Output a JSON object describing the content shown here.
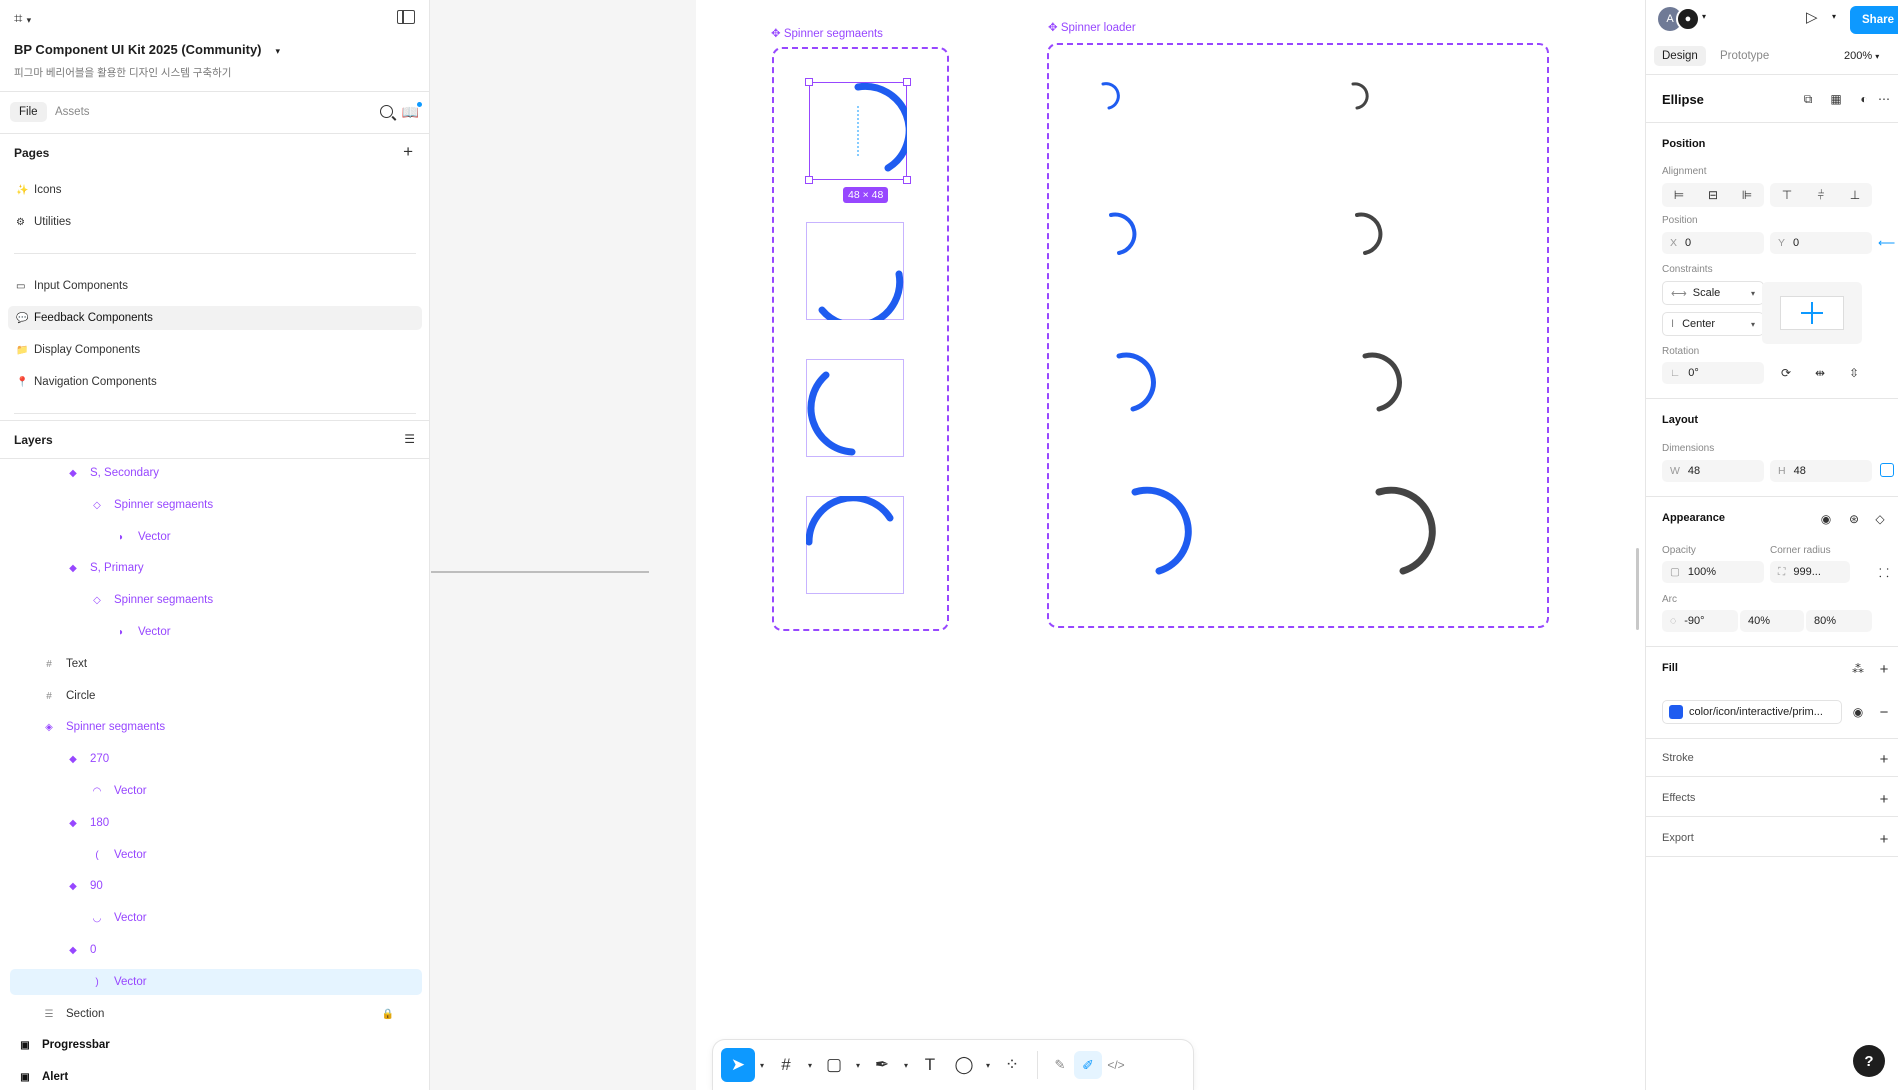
{
  "app": {
    "file_name": "BP Component UI Kit 2025 (Community)",
    "file_subtitle": "피그마 베리어블을 활용한 디자인 시스템 구축하기",
    "tabs": [
      "File",
      "Assets"
    ]
  },
  "pages": {
    "title": "Pages",
    "items": [
      {
        "icon": "✨",
        "label": "Icons"
      },
      {
        "icon": "⚙",
        "label": "Utilities"
      },
      {
        "icon": "▭",
        "label": "Input Components"
      },
      {
        "icon": "💬",
        "label": "Feedback Components",
        "active": true
      },
      {
        "icon": "📁",
        "label": "Display Components"
      },
      {
        "icon": "📍",
        "label": "Navigation Components"
      }
    ]
  },
  "layers": {
    "title": "Layers",
    "items": [
      {
        "label": "S, Secondary",
        "icon": "◆",
        "indent": 2,
        "style": "purple"
      },
      {
        "label": "Spinner segmaents",
        "icon": "◇",
        "indent": 3,
        "style": "purple"
      },
      {
        "label": "Vector",
        "icon": "◗",
        "indent": 4,
        "style": "purple"
      },
      {
        "label": "S, Primary",
        "icon": "◆",
        "indent": 2,
        "style": "purple"
      },
      {
        "label": "Spinner segmaents",
        "icon": "◇",
        "indent": 3,
        "style": "purple"
      },
      {
        "label": "Vector",
        "icon": "◗",
        "indent": 4,
        "style": "purple"
      },
      {
        "label": "Text",
        "icon": "#",
        "indent": 1,
        "style": "gray"
      },
      {
        "label": "Circle",
        "icon": "#",
        "indent": 1,
        "style": "gray"
      },
      {
        "label": "Spinner segmaents",
        "icon": "◈",
        "indent": 1,
        "style": "purple"
      },
      {
        "label": "270",
        "icon": "◆",
        "indent": 2,
        "style": "purple"
      },
      {
        "label": "Vector",
        "icon": "◠",
        "indent": 3,
        "style": "purple"
      },
      {
        "label": "180",
        "icon": "◆",
        "indent": 2,
        "style": "purple"
      },
      {
        "label": "Vector",
        "icon": "(",
        "indent": 3,
        "style": "purple"
      },
      {
        "label": "90",
        "icon": "◆",
        "indent": 2,
        "style": "purple"
      },
      {
        "label": "Vector",
        "icon": "◡",
        "indent": 3,
        "style": "purple"
      },
      {
        "label": "0",
        "icon": "◆",
        "indent": 2,
        "style": "purple"
      },
      {
        "label": "Vector",
        "icon": ")",
        "indent": 3,
        "style": "purple",
        "selected": true
      },
      {
        "label": "Section",
        "icon": "☰",
        "indent": 1,
        "style": "gray",
        "locked": true
      },
      {
        "label": "Progressbar",
        "icon": "▣",
        "indent": 0,
        "style": "bold"
      },
      {
        "label": "Alert",
        "icon": "▣",
        "indent": 0,
        "style": "bold"
      }
    ]
  },
  "canvas": {
    "frame1_label": "Spinner segmaents",
    "frame2_label": "Spinner loader",
    "selection_size": "48 × 48",
    "primary_color": "#1f5cf0",
    "secondary_color": "#444444",
    "frame_color": "#9747ff"
  },
  "toolbar": {
    "tools": [
      "move-tool",
      "frame-tool",
      "shape-tool",
      "pen-tool",
      "text-tool",
      "comment-tool",
      "actions-tool"
    ],
    "modes": [
      "draw-mode",
      "design-mode",
      "dev-mode"
    ]
  },
  "right": {
    "avatar_letter": "A",
    "share": "Share",
    "tabs": [
      "Design",
      "Prototype"
    ],
    "zoom": "200%",
    "layer_type": "Ellipse",
    "position_title": "Position",
    "alignment_label": "Alignment",
    "position_label": "Position",
    "x": "0",
    "y": "0",
    "constraints_label": "Constraints",
    "constraint_h": "Scale",
    "constraint_v": "Center",
    "rotation_label": "Rotation",
    "rotation": "0°",
    "layout_title": "Layout",
    "dimensions_label": "Dimensions",
    "w": "48",
    "h": "48",
    "appearance_title": "Appearance",
    "opacity_label": "Opacity",
    "opacity": "100%",
    "corner_radius_label": "Corner radius",
    "corner_radius": "999...",
    "arc_label": "Arc",
    "arc_start": "-90°",
    "arc_sweep": "40%",
    "arc_ratio": "80%",
    "fill_title": "Fill",
    "fill_value": "color/icon/interactive/prim...",
    "fill_color": "#1f5cf0",
    "stroke_title": "Stroke",
    "effects_title": "Effects",
    "export_title": "Export",
    "help": "?"
  }
}
